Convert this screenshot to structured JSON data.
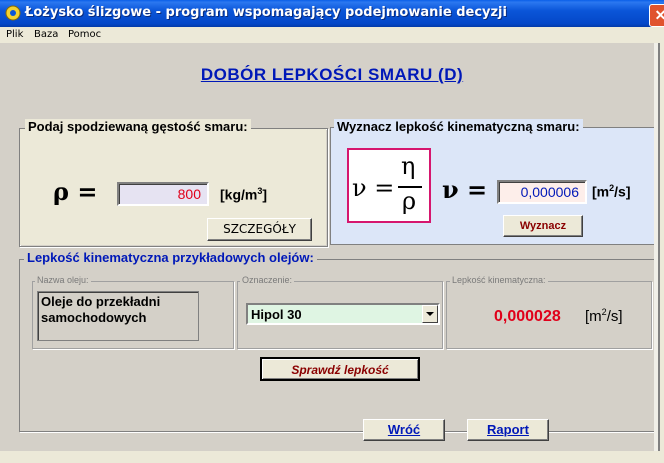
{
  "window": {
    "title": "Łożysko ślizgowe - program wspomagający podejmowanie decyzji",
    "close_glyph": "✕"
  },
  "menu": {
    "items": [
      "Plik",
      "Baza",
      "Pomoc"
    ]
  },
  "page_title": "DOBÓR LEPKOŚCI SMARU (D)",
  "density": {
    "group_label": "Podaj spodziewaną gęstość smaru:",
    "symbol": "ρ =",
    "value": "800",
    "unit_main": "[kg/m",
    "unit_sup": "3",
    "unit_end": "]",
    "details_button": "SZCZEGÓŁY"
  },
  "viscosity": {
    "group_label": "Wyznacz lepkość kinematyczną smaru:",
    "formula_lhs": "ν =",
    "formula_num": "η",
    "formula_den": "ρ",
    "symbol": "ν =",
    "value": "0,000006",
    "unit_main": "[m",
    "unit_sup": "2",
    "unit_end": "/s]",
    "compute_button": "Wyznacz"
  },
  "examples": {
    "group_label": "Lepkość kinematyczna przykładowych olejów:",
    "oil_name_label": "Nazwa oleju:",
    "oil_name_value": "Oleje do przekładni samochodowych",
    "designation_label": "Oznaczenie:",
    "designation_value": "Hipol 30",
    "kin_label": "Lepkość kinematyczna:",
    "kin_value": "0,000028",
    "kin_unit_main": "[m",
    "kin_unit_sup": "2",
    "kin_unit_end": "/s]",
    "check_button": "Sprawdź lepkość"
  },
  "footer": {
    "back_button": "Wróć",
    "report_button": "Raport"
  },
  "colors": {
    "title_blue": "#0018b8",
    "panel_blue": "#dce6f8",
    "accent_red": "#e0001a",
    "formula_border": "#d6166e",
    "combo_green": "#dff5e3"
  }
}
